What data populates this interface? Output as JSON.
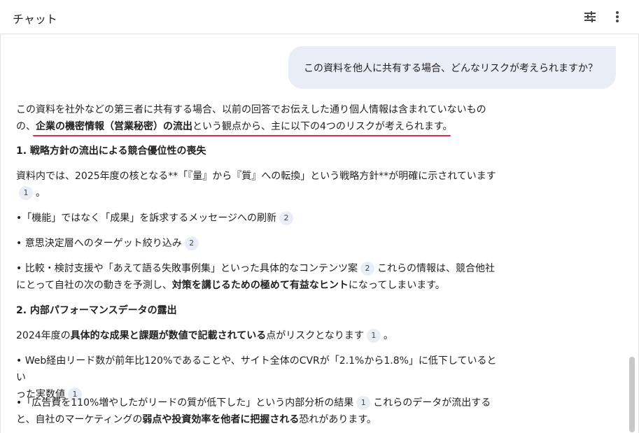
{
  "header": {
    "title": "チャット",
    "icons": [
      "tune-icon",
      "more-vert-icon"
    ]
  },
  "user_message": "この資料を他人に共有する場合、どんなリスクが考えられますか？",
  "response": {
    "intro_1": "この資料を社外などの第三者に共有する場合、以前の回答でお伝えした通り個人情報は含まれていないもの",
    "intro_2a": "の、",
    "intro_2b": "企業の機密情報（営業秘密）の流出",
    "intro_2c": "という観点から、主に以下の4つのリスクが考えられます。",
    "h1": "1. 戦略方針の流出による競合優位性の喪失",
    "p1_a": "資料内では、2025年度の核となる**「『量』から『質』への転換」という戦略方針**が明確に示されています",
    "p1_cite": "1",
    "p1_b": "。",
    "b1_text": "•「機能」ではなく「成果」を訴求するメッセージへの刷新",
    "b1_cite": "2",
    "b2_text": "• 意思決定層へのターゲット絞り込み",
    "b2_cite": "2",
    "b3_a": "• 比較・検討支援や「あえて語る失敗事例集」といった具体的なコンテンツ案",
    "b3_cite": "2",
    "b3_b": "これらの情報は、競合他社",
    "b3_c": "にとって自社の次の動きを予測し、",
    "b3_bold": "対策を講じるための極めて有益なヒント",
    "b3_d": "になってしまいます。",
    "h2": "2. 内部パフォーマンスデータの露出",
    "p2_a": "2024年度の",
    "p2_bold": "具体的な成果と課題が数値で記載されている",
    "p2_b": "点がリスクとなります",
    "p2_cite": "1",
    "p2_c": "。",
    "b4_a": "• Web経由リード数が前年比120%であることや、サイト全体のCVRが「2.1%から1.8%」に低下しているとい",
    "b4_b": "った実数値",
    "b4_cite": "1",
    "b5_a": "•「広告費を110%増やしたがリードの質が低下した」という内部分析の結果",
    "b5_cite": "1",
    "b5_b": "これらのデータが流出する",
    "b5_c": "と、自社のマーケティングの",
    "b5_bold": "弱点や投資効率を他者に把握される",
    "b5_d": "恐れがあります。"
  },
  "colors": {
    "accent_underline": "#d92b4b",
    "user_bubble": "#e9eef6",
    "citation_chip": "#e9eef6"
  }
}
